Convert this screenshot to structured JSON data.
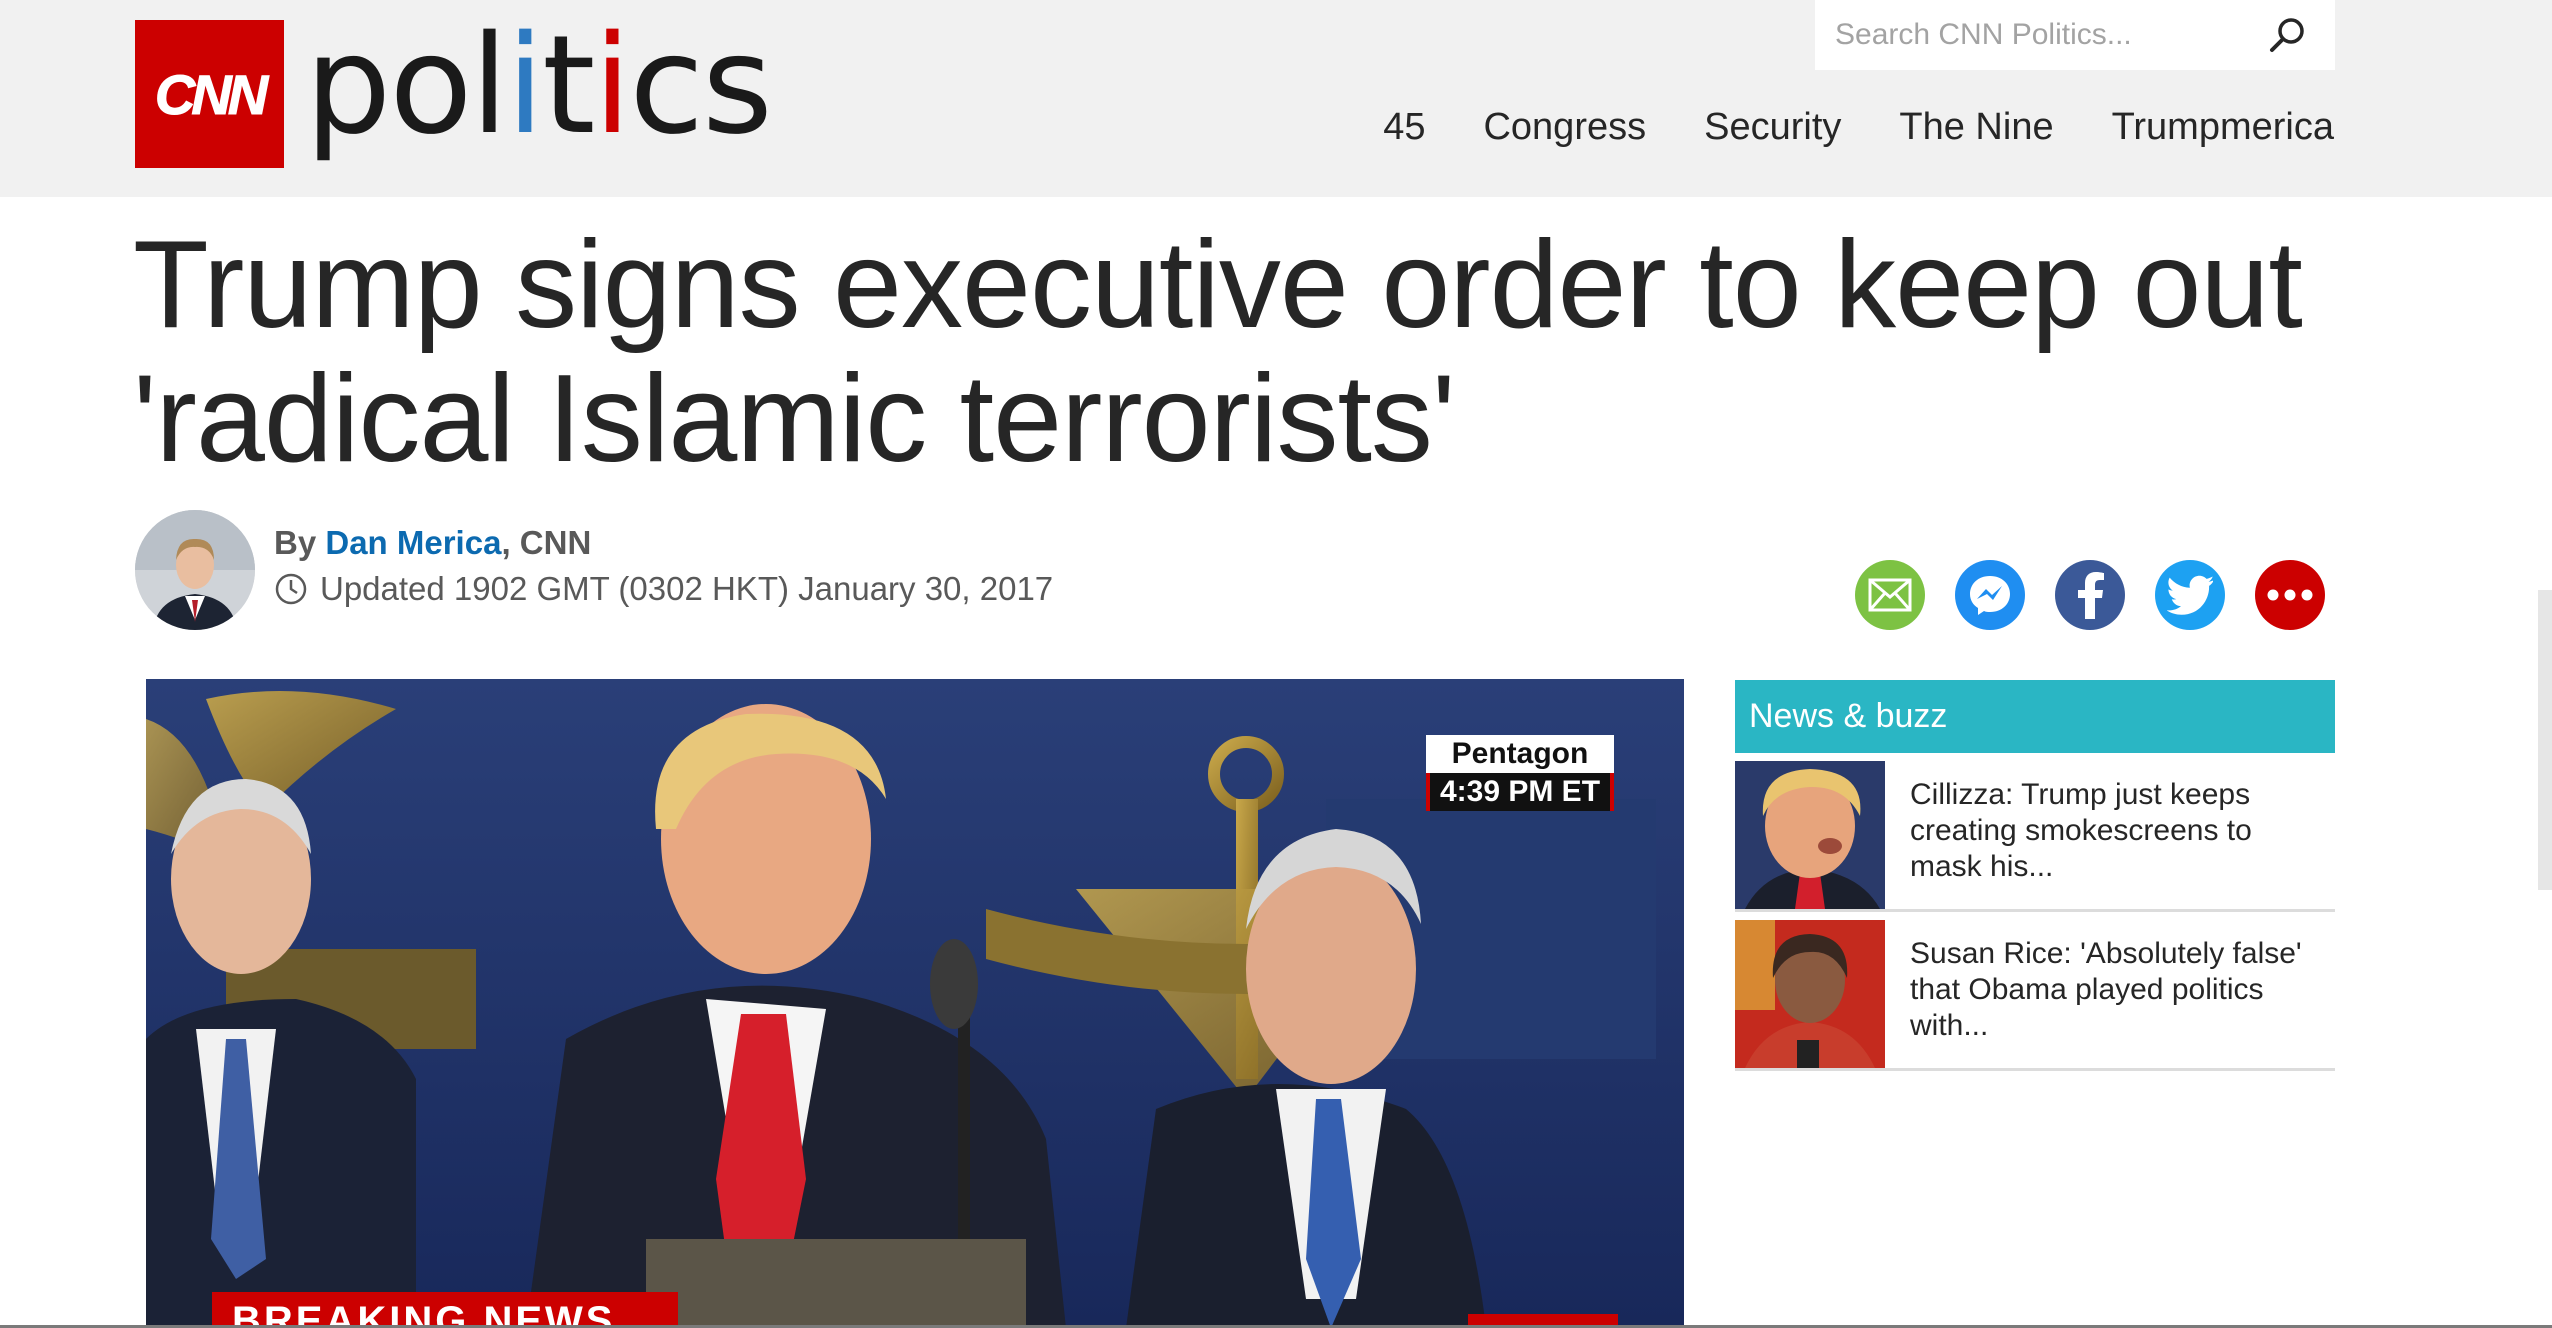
{
  "header": {
    "logo_text": "CNN",
    "section": {
      "p1": "pol",
      "i1": "i",
      "t": "t",
      "i2": "i",
      "rest": "cs"
    },
    "search_placeholder": "Search CNN Politics...",
    "nav": [
      "45",
      "Congress",
      "Security",
      "The Nine",
      "Trumpmerica"
    ]
  },
  "article": {
    "headline": "Trump signs executive order to keep out 'radical Islamic terrorists'",
    "by_label": "By",
    "author": "Dan Merica",
    "outlet": ", CNN",
    "updated": "Updated 1902 GMT (0302 HKT) January 30, 2017"
  },
  "share": {
    "icons": [
      "email-icon",
      "messenger-icon",
      "facebook-icon",
      "twitter-icon",
      "more-icon"
    ],
    "colors": [
      "#7dc243",
      "#1f8ef1",
      "#3b5998",
      "#1da1f2",
      "#cc0000"
    ]
  },
  "hero": {
    "location": "Pentagon",
    "time": "4:39 PM ET",
    "banner": "BREAKING NEWS"
  },
  "sidebar": {
    "title": "News & buzz",
    "items": [
      {
        "text": "Cillizza: Trump just keeps creating smokescreens to mask his..."
      },
      {
        "text": "Susan Rice: 'Absolutely false' that Obama played politics with..."
      }
    ]
  },
  "colors": {
    "cnn_red": "#cc0000",
    "link_blue": "#0c6ab0",
    "buzz_teal": "#2ab6c4",
    "header_bg": "#f1f1f1"
  }
}
